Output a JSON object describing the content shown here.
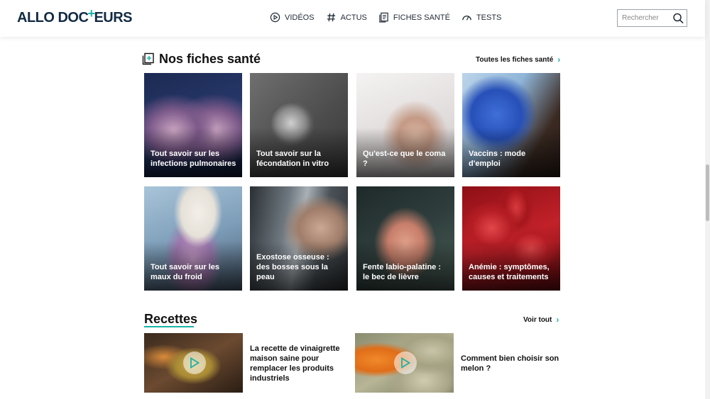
{
  "header": {
    "logo_left": "ALLO DOC",
    "logo_plus": "+",
    "logo_right": "EURS",
    "nav": [
      {
        "label": "VIDÉOS",
        "icon": "play-circle-icon"
      },
      {
        "label": "ACTUS",
        "icon": "hashtag-icon"
      },
      {
        "label": "FICHES SANTÉ",
        "icon": "document-icon"
      },
      {
        "label": "TESTS",
        "icon": "gauge-icon"
      }
    ],
    "search_placeholder": "Rechercher"
  },
  "fiches": {
    "title": "Nos fiches santé",
    "see_all": "Toutes les fiches santé",
    "items": [
      {
        "label": "Tout savoir sur les infections pulmonaires"
      },
      {
        "label": "Tout savoir sur la fécondation in vitro"
      },
      {
        "label": "Qu'est-ce que le coma ?"
      },
      {
        "label": "Vaccins : mode d'emploi"
      },
      {
        "label": "Tout savoir sur les maux du froid"
      },
      {
        "label": "Exostose osseuse : des bosses sous la peau"
      },
      {
        "label": "Fente labio-palatine : le bec de lièvre"
      },
      {
        "label": "Anémie : symptômes, causes et traitements"
      }
    ]
  },
  "recettes": {
    "title": "Recettes",
    "see_all": "Voir tout",
    "items": [
      {
        "title": "La recette de vinaigrette maison saine pour remplacer les produits industriels"
      },
      {
        "title": "Comment bien choisir son melon ?"
      }
    ]
  },
  "colors": {
    "accent": "#1bb3a7",
    "brand": "#122b44"
  }
}
